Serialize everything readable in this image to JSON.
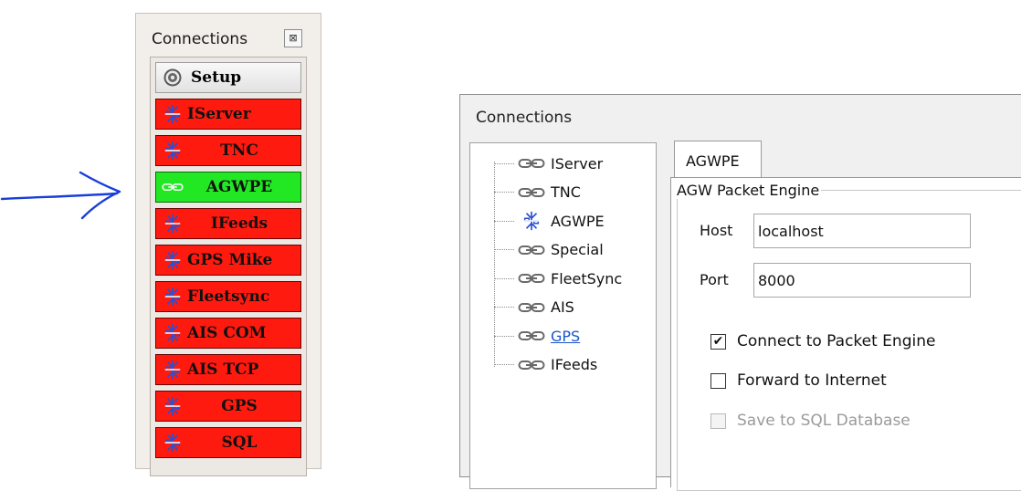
{
  "left_panel": {
    "title": "Connections",
    "close_glyph": "⊠",
    "setup_label": "Setup",
    "items": [
      {
        "label": "IServer",
        "status": "red",
        "icon": "broken-link-icon"
      },
      {
        "label": "TNC",
        "status": "red",
        "icon": "broken-link-icon"
      },
      {
        "label": "AGWPE",
        "status": "green",
        "icon": "link-icon"
      },
      {
        "label": "IFeeds",
        "status": "red",
        "icon": "broken-link-icon"
      },
      {
        "label": "GPS Mike",
        "status": "red",
        "icon": "broken-link-icon"
      },
      {
        "label": "Fleetsync",
        "status": "red",
        "icon": "broken-link-icon"
      },
      {
        "label": "AIS COM",
        "status": "red",
        "icon": "broken-link-icon"
      },
      {
        "label": "AIS TCP",
        "status": "red",
        "icon": "broken-link-icon"
      },
      {
        "label": "GPS",
        "status": "red",
        "icon": "broken-link-icon"
      },
      {
        "label": "SQL",
        "status": "red",
        "icon": "broken-link-icon"
      }
    ],
    "colors": {
      "red": "#ff1a0f",
      "green": "#22e824"
    }
  },
  "dialog": {
    "title": "Connections",
    "tree": [
      {
        "label": "IServer",
        "icon": "link-icon"
      },
      {
        "label": "TNC",
        "icon": "link-icon"
      },
      {
        "label": "AGWPE",
        "icon": "broken-link-icon"
      },
      {
        "label": "Special",
        "icon": "link-icon"
      },
      {
        "label": "FleetSync",
        "icon": "link-icon"
      },
      {
        "label": "AIS",
        "icon": "link-icon"
      },
      {
        "label": "GPS",
        "icon": "link-icon",
        "hover": true
      },
      {
        "label": "IFeeds",
        "icon": "link-icon"
      }
    ],
    "tab_label": "AGWPE",
    "group_label": "AGW Packet Engine",
    "host_label": "Host",
    "host_value": "localhost",
    "port_label": "Port",
    "port_value": "8000",
    "connect_label": "Connect to Packet Engine",
    "connect_checked": true,
    "forward_label": "Forward to Internet",
    "forward_checked": false,
    "sql_label": "Save to SQL Database",
    "sql_checked": false,
    "sql_enabled": false
  }
}
